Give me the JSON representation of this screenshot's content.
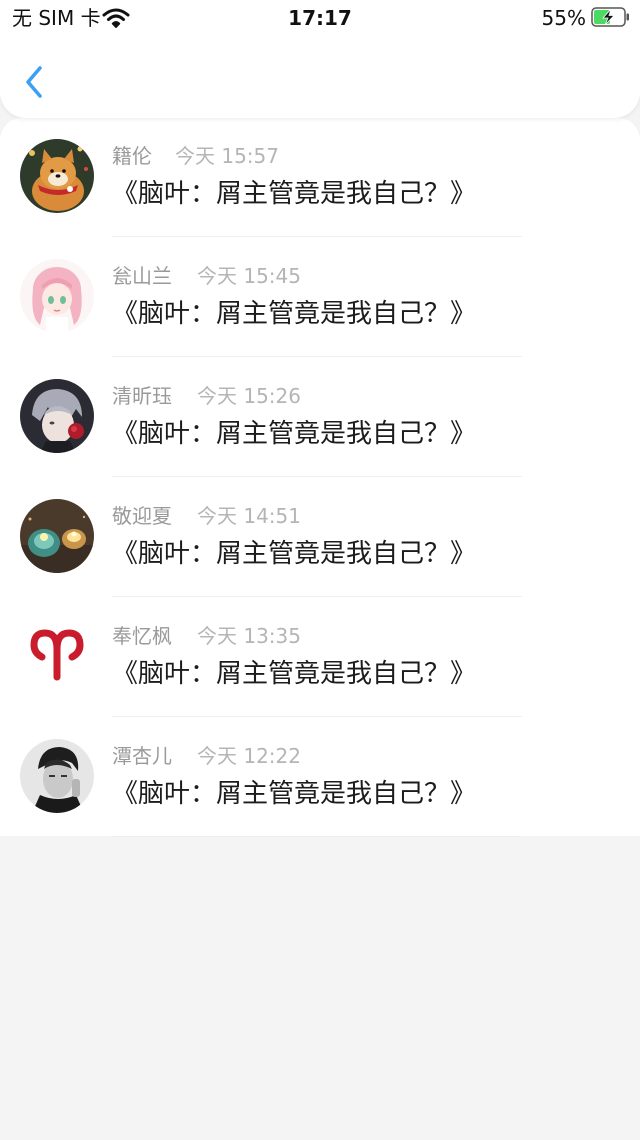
{
  "status_bar": {
    "carrier": "无 SIM 卡",
    "time": "17:17",
    "battery_percent": "55%",
    "battery_level": 0.55,
    "wifi_icon": "wifi-icon",
    "battery_icon": "battery-charging-icon"
  },
  "nav": {
    "back_icon": "chevron-left-icon",
    "accent_color": "#3a9ff5"
  },
  "comments": [
    {
      "name": "籍伦",
      "time": "今天 15:57",
      "content": "《脑叶：屑主管竟是我自己？》",
      "avatar": "shiba-dog-avatar"
    },
    {
      "name": "瓮山兰",
      "time": "今天 15:45",
      "content": "《脑叶：屑主管竟是我自己？》",
      "avatar": "anime-girl-pink-hair-avatar"
    },
    {
      "name": "清昕珏",
      "time": "今天 15:26",
      "content": "《脑叶：屑主管竟是我自己？》",
      "avatar": "anime-boy-rose-avatar"
    },
    {
      "name": "敬迎夏",
      "time": "今天 14:51",
      "content": "《脑叶：屑主管竟是我自己？》",
      "avatar": "candle-jars-avatar"
    },
    {
      "name": "奉忆枫",
      "time": "今天 13:35",
      "content": "《脑叶：屑主管竟是我自己？》",
      "avatar": "aries-symbol-avatar"
    },
    {
      "name": "潭杏儿",
      "time": "今天 12:22",
      "content": "《脑叶：屑主管竟是我自己？》",
      "avatar": "man-portrait-bw-avatar"
    }
  ]
}
